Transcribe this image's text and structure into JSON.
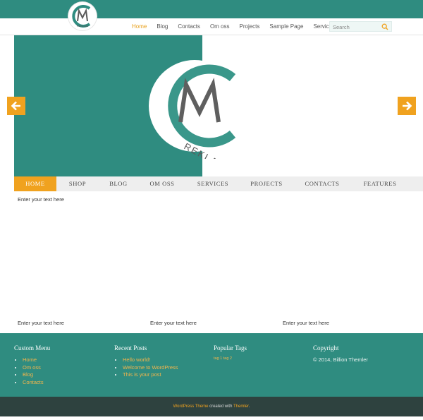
{
  "nav": {
    "items": [
      {
        "label": "Home",
        "active": true
      },
      {
        "label": "Blog",
        "active": false
      },
      {
        "label": "Contacts",
        "active": false
      },
      {
        "label": "Om oss",
        "active": false
      },
      {
        "label": "Projects",
        "active": false
      },
      {
        "label": "Sample Page",
        "active": false
      },
      {
        "label": "Services",
        "active": false
      }
    ]
  },
  "search": {
    "placeholder": "Search"
  },
  "logo": {
    "text": "REKLAM",
    "letters": "CM"
  },
  "menubar": {
    "items": [
      {
        "label": "HOME",
        "active": true
      },
      {
        "label": "SHOP",
        "active": false
      },
      {
        "label": "BLOG",
        "active": false
      },
      {
        "label": "OM OSS",
        "active": false
      },
      {
        "label": "SERVICES",
        "active": false
      },
      {
        "label": "PROJECTS",
        "active": false
      },
      {
        "label": "CONTACTS",
        "active": false
      },
      {
        "label": "FEATURES",
        "active": false
      }
    ]
  },
  "content": {
    "main_text": "Enter your text here",
    "col1_text": "Enter your text here",
    "col2_text": "Enter your text here",
    "col3_text": "Enter your text here"
  },
  "footer": {
    "custom_menu": {
      "title": "Custom Menu",
      "items": [
        "Home",
        "Om oss",
        "Blog",
        "Contacts"
      ]
    },
    "recent_posts": {
      "title": "Recent Posts",
      "items": [
        "Hello world!",
        "Welcome to WordPress",
        "This is your post"
      ]
    },
    "popular_tags": {
      "title": "Popular Tags",
      "tags": "tag 1  tag 2"
    },
    "copyright": {
      "title": "Copyright",
      "text": "© 2014, Billion Themler"
    }
  },
  "bottom": {
    "link1": "WordPress Theme",
    "middle": " created with ",
    "link2": "Themler",
    "end": "."
  },
  "colors": {
    "teal": "#2f8c80",
    "orange": "#f0a21f",
    "dark": "#2e423f",
    "gray": "#5a5a5a"
  }
}
